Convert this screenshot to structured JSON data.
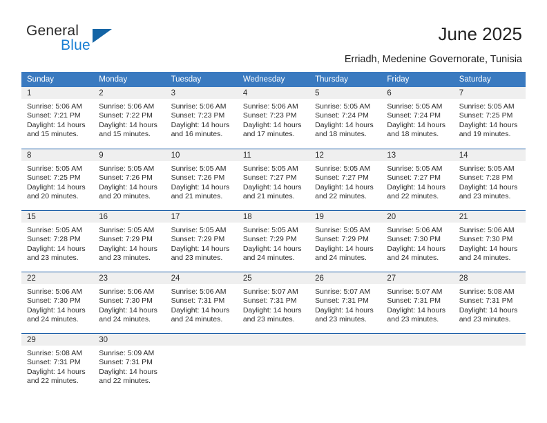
{
  "brand": {
    "name_part1": "General",
    "name_part2": "Blue"
  },
  "header": {
    "title": "June 2025",
    "location": "Erriadh, Medenine Governorate, Tunisia"
  },
  "colors": {
    "header_blue": "#3a7ac0",
    "row_divider_blue": "#1d5fa8",
    "daynum_bar": "#efefef",
    "brand_blue": "#1a7fd4",
    "logo_triangle": "#1464a5"
  },
  "weekdays": [
    "Sunday",
    "Monday",
    "Tuesday",
    "Wednesday",
    "Thursday",
    "Friday",
    "Saturday"
  ],
  "weeks": [
    [
      {
        "day": "1",
        "sunrise": "Sunrise: 5:06 AM",
        "sunset": "Sunset: 7:21 PM",
        "daylight": "Daylight: 14 hours and 15 minutes."
      },
      {
        "day": "2",
        "sunrise": "Sunrise: 5:06 AM",
        "sunset": "Sunset: 7:22 PM",
        "daylight": "Daylight: 14 hours and 15 minutes."
      },
      {
        "day": "3",
        "sunrise": "Sunrise: 5:06 AM",
        "sunset": "Sunset: 7:23 PM",
        "daylight": "Daylight: 14 hours and 16 minutes."
      },
      {
        "day": "4",
        "sunrise": "Sunrise: 5:06 AM",
        "sunset": "Sunset: 7:23 PM",
        "daylight": "Daylight: 14 hours and 17 minutes."
      },
      {
        "day": "5",
        "sunrise": "Sunrise: 5:05 AM",
        "sunset": "Sunset: 7:24 PM",
        "daylight": "Daylight: 14 hours and 18 minutes."
      },
      {
        "day": "6",
        "sunrise": "Sunrise: 5:05 AM",
        "sunset": "Sunset: 7:24 PM",
        "daylight": "Daylight: 14 hours and 18 minutes."
      },
      {
        "day": "7",
        "sunrise": "Sunrise: 5:05 AM",
        "sunset": "Sunset: 7:25 PM",
        "daylight": "Daylight: 14 hours and 19 minutes."
      }
    ],
    [
      {
        "day": "8",
        "sunrise": "Sunrise: 5:05 AM",
        "sunset": "Sunset: 7:25 PM",
        "daylight": "Daylight: 14 hours and 20 minutes."
      },
      {
        "day": "9",
        "sunrise": "Sunrise: 5:05 AM",
        "sunset": "Sunset: 7:26 PM",
        "daylight": "Daylight: 14 hours and 20 minutes."
      },
      {
        "day": "10",
        "sunrise": "Sunrise: 5:05 AM",
        "sunset": "Sunset: 7:26 PM",
        "daylight": "Daylight: 14 hours and 21 minutes."
      },
      {
        "day": "11",
        "sunrise": "Sunrise: 5:05 AM",
        "sunset": "Sunset: 7:27 PM",
        "daylight": "Daylight: 14 hours and 21 minutes."
      },
      {
        "day": "12",
        "sunrise": "Sunrise: 5:05 AM",
        "sunset": "Sunset: 7:27 PM",
        "daylight": "Daylight: 14 hours and 22 minutes."
      },
      {
        "day": "13",
        "sunrise": "Sunrise: 5:05 AM",
        "sunset": "Sunset: 7:27 PM",
        "daylight": "Daylight: 14 hours and 22 minutes."
      },
      {
        "day": "14",
        "sunrise": "Sunrise: 5:05 AM",
        "sunset": "Sunset: 7:28 PM",
        "daylight": "Daylight: 14 hours and 23 minutes."
      }
    ],
    [
      {
        "day": "15",
        "sunrise": "Sunrise: 5:05 AM",
        "sunset": "Sunset: 7:28 PM",
        "daylight": "Daylight: 14 hours and 23 minutes."
      },
      {
        "day": "16",
        "sunrise": "Sunrise: 5:05 AM",
        "sunset": "Sunset: 7:29 PM",
        "daylight": "Daylight: 14 hours and 23 minutes."
      },
      {
        "day": "17",
        "sunrise": "Sunrise: 5:05 AM",
        "sunset": "Sunset: 7:29 PM",
        "daylight": "Daylight: 14 hours and 23 minutes."
      },
      {
        "day": "18",
        "sunrise": "Sunrise: 5:05 AM",
        "sunset": "Sunset: 7:29 PM",
        "daylight": "Daylight: 14 hours and 24 minutes."
      },
      {
        "day": "19",
        "sunrise": "Sunrise: 5:05 AM",
        "sunset": "Sunset: 7:29 PM",
        "daylight": "Daylight: 14 hours and 24 minutes."
      },
      {
        "day": "20",
        "sunrise": "Sunrise: 5:06 AM",
        "sunset": "Sunset: 7:30 PM",
        "daylight": "Daylight: 14 hours and 24 minutes."
      },
      {
        "day": "21",
        "sunrise": "Sunrise: 5:06 AM",
        "sunset": "Sunset: 7:30 PM",
        "daylight": "Daylight: 14 hours and 24 minutes."
      }
    ],
    [
      {
        "day": "22",
        "sunrise": "Sunrise: 5:06 AM",
        "sunset": "Sunset: 7:30 PM",
        "daylight": "Daylight: 14 hours and 24 minutes."
      },
      {
        "day": "23",
        "sunrise": "Sunrise: 5:06 AM",
        "sunset": "Sunset: 7:30 PM",
        "daylight": "Daylight: 14 hours and 24 minutes."
      },
      {
        "day": "24",
        "sunrise": "Sunrise: 5:06 AM",
        "sunset": "Sunset: 7:31 PM",
        "daylight": "Daylight: 14 hours and 24 minutes."
      },
      {
        "day": "25",
        "sunrise": "Sunrise: 5:07 AM",
        "sunset": "Sunset: 7:31 PM",
        "daylight": "Daylight: 14 hours and 23 minutes."
      },
      {
        "day": "26",
        "sunrise": "Sunrise: 5:07 AM",
        "sunset": "Sunset: 7:31 PM",
        "daylight": "Daylight: 14 hours and 23 minutes."
      },
      {
        "day": "27",
        "sunrise": "Sunrise: 5:07 AM",
        "sunset": "Sunset: 7:31 PM",
        "daylight": "Daylight: 14 hours and 23 minutes."
      },
      {
        "day": "28",
        "sunrise": "Sunrise: 5:08 AM",
        "sunset": "Sunset: 7:31 PM",
        "daylight": "Daylight: 14 hours and 23 minutes."
      }
    ],
    [
      {
        "day": "29",
        "sunrise": "Sunrise: 5:08 AM",
        "sunset": "Sunset: 7:31 PM",
        "daylight": "Daylight: 14 hours and 22 minutes."
      },
      {
        "day": "30",
        "sunrise": "Sunrise: 5:09 AM",
        "sunset": "Sunset: 7:31 PM",
        "daylight": "Daylight: 14 hours and 22 minutes."
      },
      {
        "day": "",
        "sunrise": "",
        "sunset": "",
        "daylight": ""
      },
      {
        "day": "",
        "sunrise": "",
        "sunset": "",
        "daylight": ""
      },
      {
        "day": "",
        "sunrise": "",
        "sunset": "",
        "daylight": ""
      },
      {
        "day": "",
        "sunrise": "",
        "sunset": "",
        "daylight": ""
      },
      {
        "day": "",
        "sunrise": "",
        "sunset": "",
        "daylight": ""
      }
    ]
  ]
}
